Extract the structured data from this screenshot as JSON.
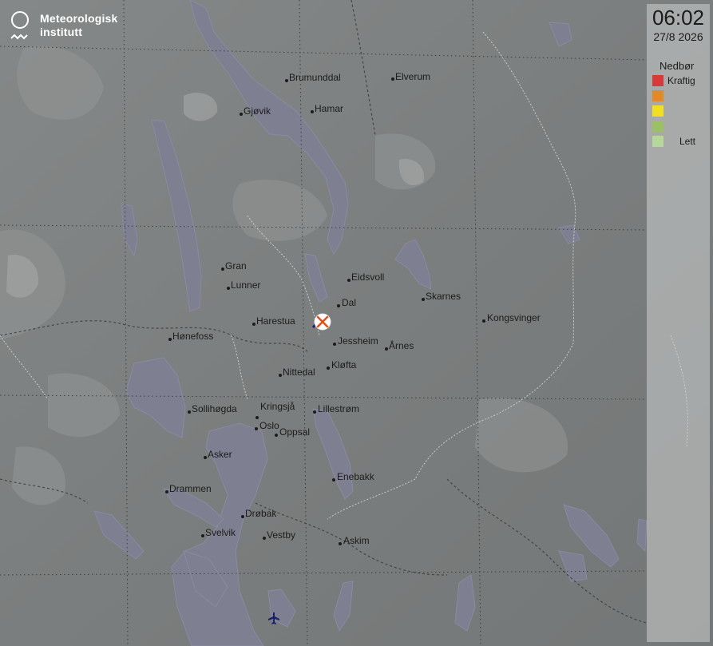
{
  "logo": {
    "line1": "Meteorologisk",
    "line2": "institutt"
  },
  "panel": {
    "time": "06:02",
    "date": "27/8 2026",
    "legend_title": "Nedbør",
    "legend_high": "Kraftig",
    "legend_low": "Lett",
    "legend_colors": [
      "#d83a3a",
      "#e08a2a",
      "#f0e020",
      "#9cc064",
      "#b6d79c"
    ]
  },
  "colors": {
    "land": "#7d8080",
    "water": "#7f7f92",
    "panel": "#cdd0d0"
  },
  "cities": [
    {
      "name": "Brumunddal"
    },
    {
      "name": "Elverum"
    },
    {
      "name": "Gjøvik"
    },
    {
      "name": "Hamar"
    },
    {
      "name": "Gran"
    },
    {
      "name": "Lunner"
    },
    {
      "name": "Eidsvoll"
    },
    {
      "name": "Dal"
    },
    {
      "name": "Skarnes"
    },
    {
      "name": "Kongsvinger"
    },
    {
      "name": "Harestua"
    },
    {
      "name": "Hønefoss"
    },
    {
      "name": "Jessheim"
    },
    {
      "name": "Årnes"
    },
    {
      "name": "Nittedal"
    },
    {
      "name": "Kløfta"
    },
    {
      "name": "Sollihøgda"
    },
    {
      "name": "Kringsjå"
    },
    {
      "name": "Lillestrøm"
    },
    {
      "name": "Oslo"
    },
    {
      "name": "Oppsal"
    },
    {
      "name": "Asker"
    },
    {
      "name": "Enebakk"
    },
    {
      "name": "Drammen"
    },
    {
      "name": "Drøbak"
    },
    {
      "name": "Svelvik"
    },
    {
      "name": "Vestby"
    },
    {
      "name": "Askim"
    }
  ],
  "icons": {
    "location_marker": "close-circle-icon",
    "airport": "airplane-icon"
  }
}
